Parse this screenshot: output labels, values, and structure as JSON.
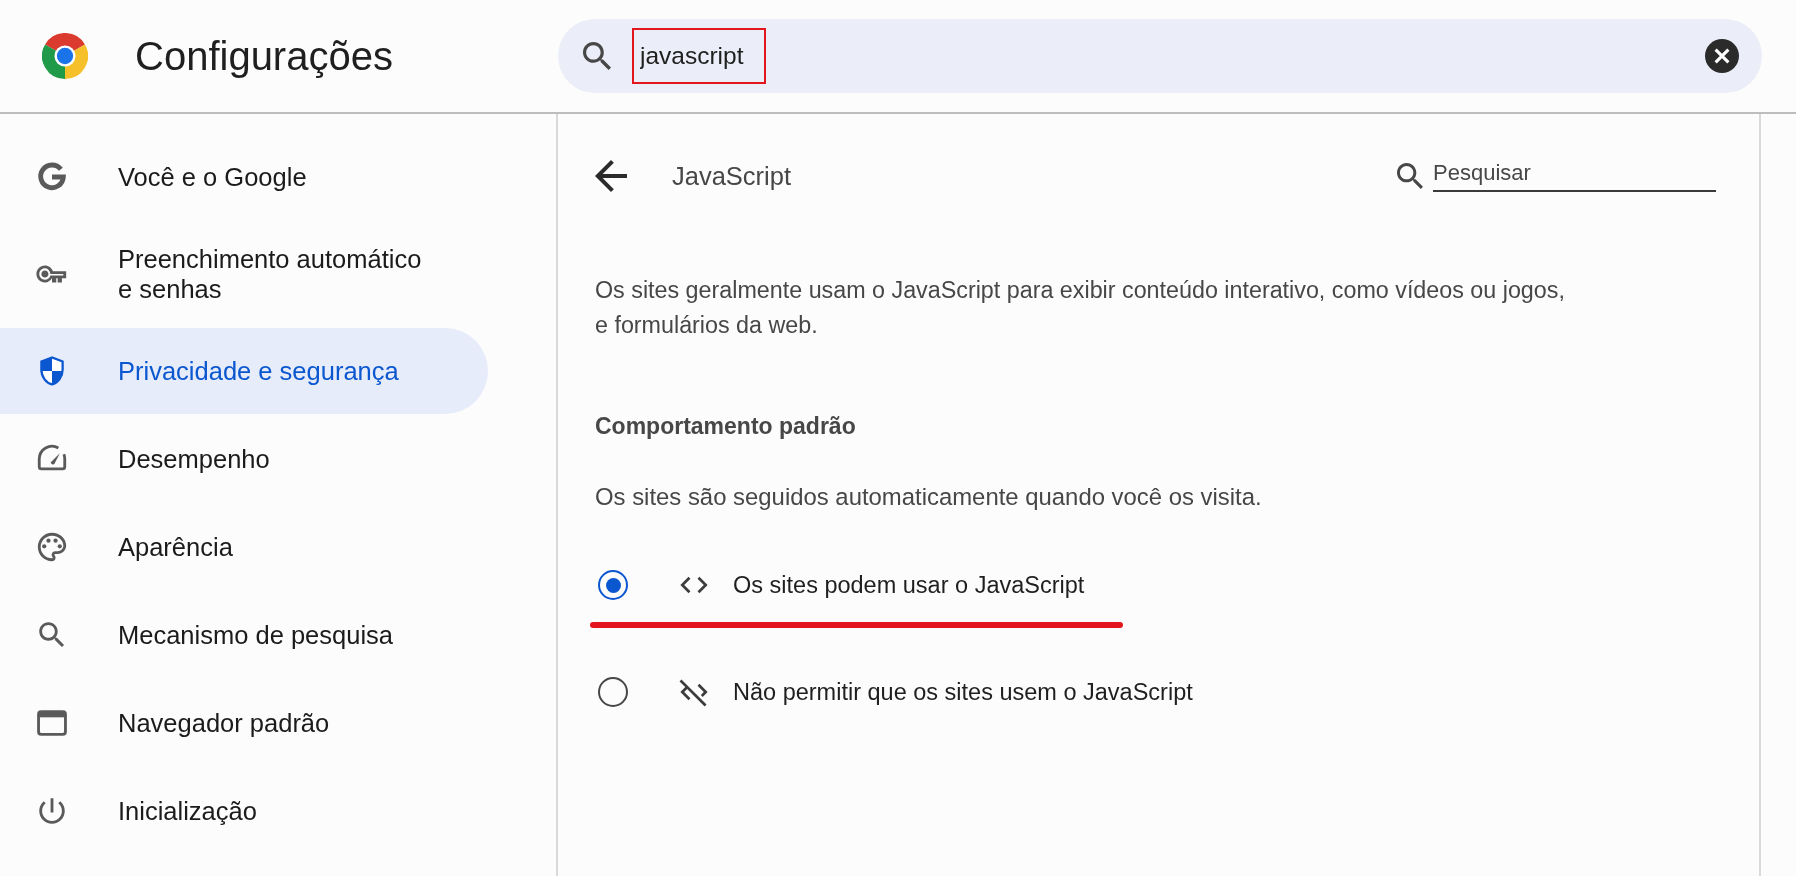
{
  "header": {
    "title": "Configurações",
    "search": {
      "value": "javascript",
      "highlighted": true
    }
  },
  "sidebar": {
    "items": [
      {
        "label": "Você e o Google",
        "selected": false
      },
      {
        "label": "Preenchimento automático e senhas",
        "selected": false
      },
      {
        "label": "Privacidade e segurança",
        "selected": true
      },
      {
        "label": "Desempenho",
        "selected": false
      },
      {
        "label": "Aparência",
        "selected": false
      },
      {
        "label": "Mecanismo de pesquisa",
        "selected": false
      },
      {
        "label": "Navegador padrão",
        "selected": false
      },
      {
        "label": "Inicialização",
        "selected": false
      }
    ]
  },
  "page": {
    "title": "JavaScript",
    "search": {
      "placeholder": "Pesquisar"
    },
    "description": "Os sites geralmente usam o JavaScript para exibir conteúdo interativo, como vídeos ou jogos, e formulários da web.",
    "section_title": "Comportamento padrão",
    "section_description": "Os sites são seguidos automaticamente quando você os visita.",
    "options": [
      {
        "label": "Os sites podem usar o JavaScript",
        "selected": true,
        "underlined": true
      },
      {
        "label": "Não permitir que os sites usem o JavaScript",
        "selected": false,
        "underlined": false
      }
    ]
  }
}
